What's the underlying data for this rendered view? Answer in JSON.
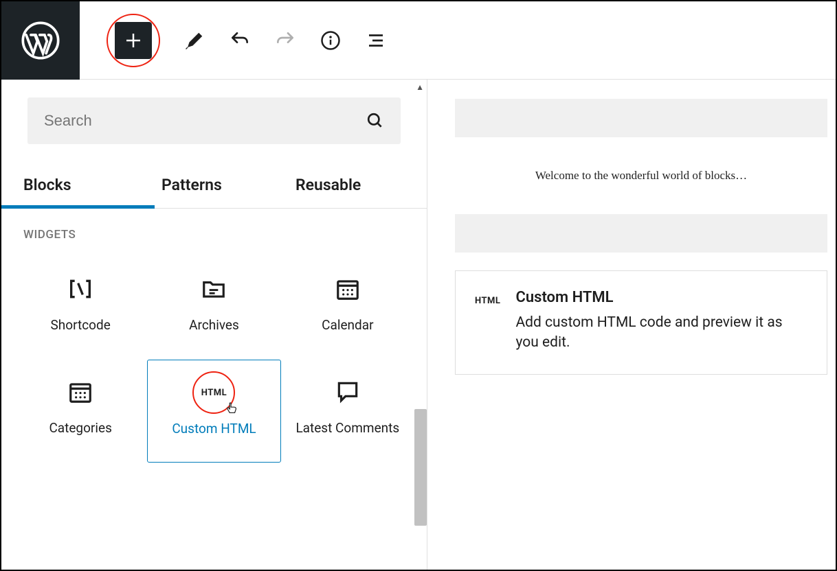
{
  "search": {
    "placeholder": "Search"
  },
  "tabs": {
    "blocks": "Blocks",
    "patterns": "Patterns",
    "reusable": "Reusable"
  },
  "section": {
    "widgets": "WIDGETS"
  },
  "blocks": {
    "shortcode": "Shortcode",
    "archives": "Archives",
    "calendar": "Calendar",
    "categories": "Categories",
    "custom_html": "Custom HTML",
    "latest_comments": "Latest Comments"
  },
  "canvas": {
    "welcome": "Welcome to the wonderful world of blocks…"
  },
  "preview": {
    "icon_text": "HTML",
    "title": "Custom HTML",
    "desc": "Add custom HTML code and preview it as you edit."
  }
}
